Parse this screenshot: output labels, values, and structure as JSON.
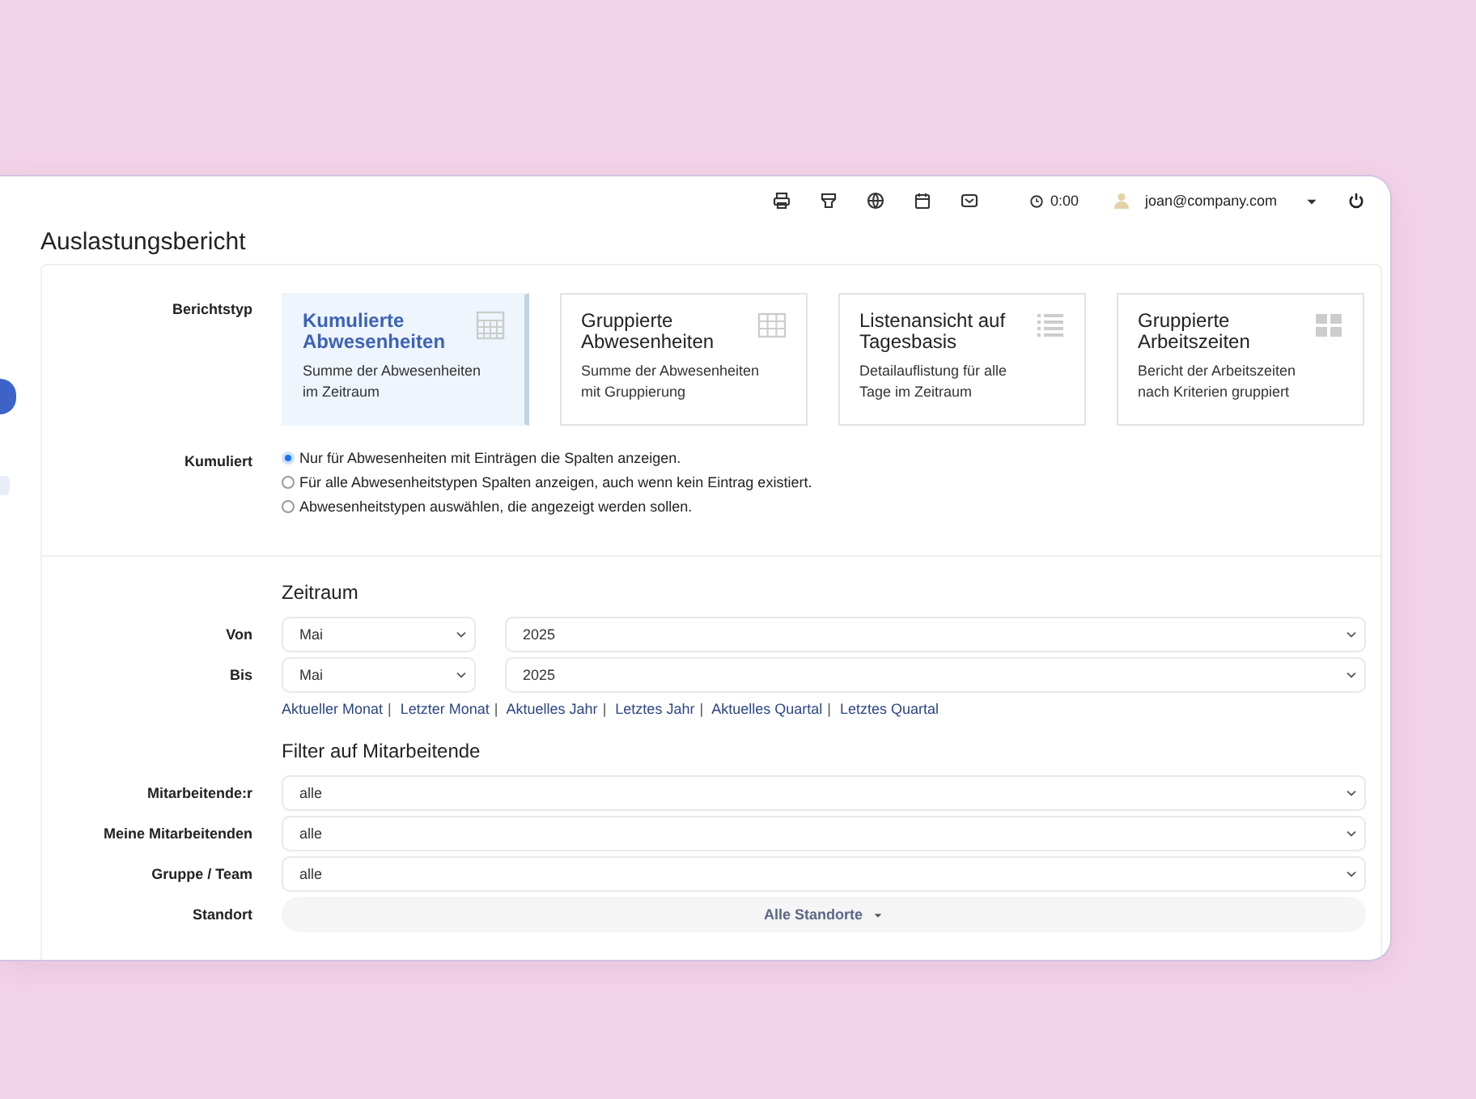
{
  "topbar": {
    "timer": "0:00",
    "user": "joan@company.com"
  },
  "sidebar": {
    "items": [
      {
        "selected": true
      },
      {
        "selected": false
      }
    ]
  },
  "title": "Auslastungsbericht",
  "report_type": {
    "label": "Berichtstyp",
    "cards": [
      {
        "title": "Kumulierte Abwesenheiten",
        "description": "Summe der Abwesenheiten im Zeitraum",
        "selected": true
      },
      {
        "title": "Gruppierte Abwesenheiten",
        "description": "Summe der Abwesenheiten mit Gruppierung",
        "selected": false
      },
      {
        "title": "Listenansicht auf Tagesbasis",
        "description": "Detailauflistung für alle Tage im Zeitraum",
        "selected": false
      },
      {
        "title": "Gruppierte Arbeitszeiten",
        "description": "Bericht der Arbeitszeiten nach Kriterien gruppiert",
        "selected": false
      }
    ]
  },
  "cumulative": {
    "label": "Kumuliert",
    "options": [
      {
        "label": "Nur für Abwesenheiten mit Einträgen die Spalten anzeigen.",
        "selected": true
      },
      {
        "label": "Für alle Abwesenheitstypen Spalten anzeigen, auch wenn kein Eintrag existiert.",
        "selected": false
      },
      {
        "label": "Abwesenheitstypen auswählen, die angezeigt werden sollen.",
        "selected": false
      }
    ]
  },
  "period": {
    "heading": "Zeitraum",
    "rows": [
      {
        "label": "Von",
        "month": "Mai",
        "year": "2025"
      },
      {
        "label": "Bis",
        "month": "Mai",
        "year": "2025"
      }
    ],
    "separator": "|",
    "shortcuts": [
      "Aktueller Monat",
      "Letzter Monat",
      "Aktuelles Jahr",
      "Letztes Jahr",
      "Aktuelles Quartal",
      "Letztes Quartal"
    ]
  },
  "filter": {
    "heading": "Filter auf Mitarbeitende",
    "rows": [
      {
        "label": "Mitarbeitende:r",
        "value": "alle",
        "kind": "select"
      },
      {
        "label": "Meine Mitarbeitenden",
        "value": "alle",
        "kind": "select"
      },
      {
        "label": "Gruppe / Team",
        "value": "alle",
        "kind": "select"
      },
      {
        "label": "Standort",
        "value": "Alle Standorte",
        "kind": "dropdown"
      }
    ]
  }
}
